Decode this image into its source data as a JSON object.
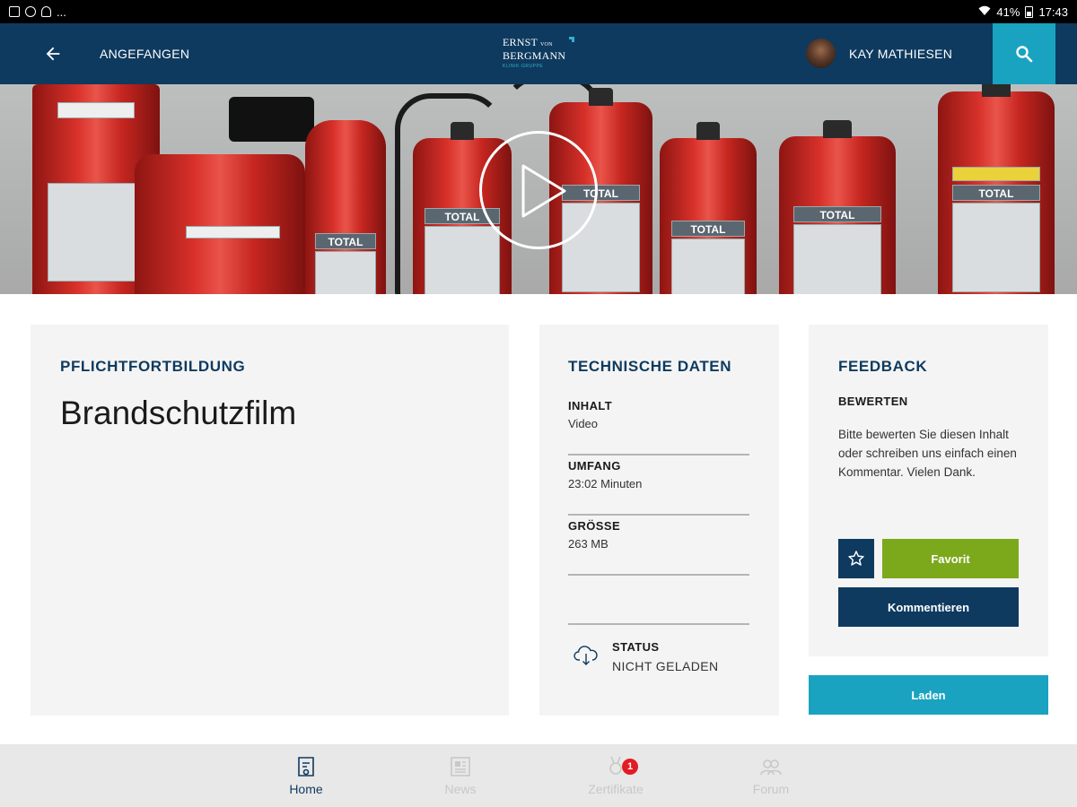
{
  "status_bar": {
    "battery": "41%",
    "time": "17:43",
    "more": "..."
  },
  "appbar": {
    "status": "ANGEFANGEN",
    "logo": {
      "line1": "ERNST",
      "line1_small": "VON",
      "line2": "BERGMANN",
      "line3": "KLINIK-GRUPPE"
    },
    "user_name": "KAY MATHIESEN"
  },
  "hero": {
    "label_text": "TOTAL"
  },
  "main_card": {
    "overline": "PFLICHTFORTBILDUNG",
    "title": "Brandschutzfilm"
  },
  "tech": {
    "heading": "TECHNISCHE DATEN",
    "items": [
      {
        "key": "INHALT",
        "value": "Video"
      },
      {
        "key": "UMFANG",
        "value": "23:02 Minuten"
      },
      {
        "key": "GRÖSSE",
        "value": "263 MB"
      }
    ],
    "status_key": "STATUS",
    "status_value": "NICHT GELADEN"
  },
  "feedback": {
    "heading": "FEEDBACK",
    "sub": "BEWERTEN",
    "text": "Bitte bewerten Sie diesen Inhalt oder schreiben uns einfach einen Kommentar. Vielen Dank.",
    "favorite_label": "Favorit",
    "comment_label": "Kommentieren"
  },
  "load_label": "Laden",
  "bottom_nav": {
    "items": [
      {
        "label": "Home"
      },
      {
        "label": "News"
      },
      {
        "label": "Zertifikate",
        "badge": "1"
      },
      {
        "label": "Forum"
      }
    ]
  },
  "colors": {
    "navy": "#0e3a5f",
    "teal": "#1aa3c0",
    "green": "#7ca81c",
    "badge_red": "#e31b23"
  }
}
